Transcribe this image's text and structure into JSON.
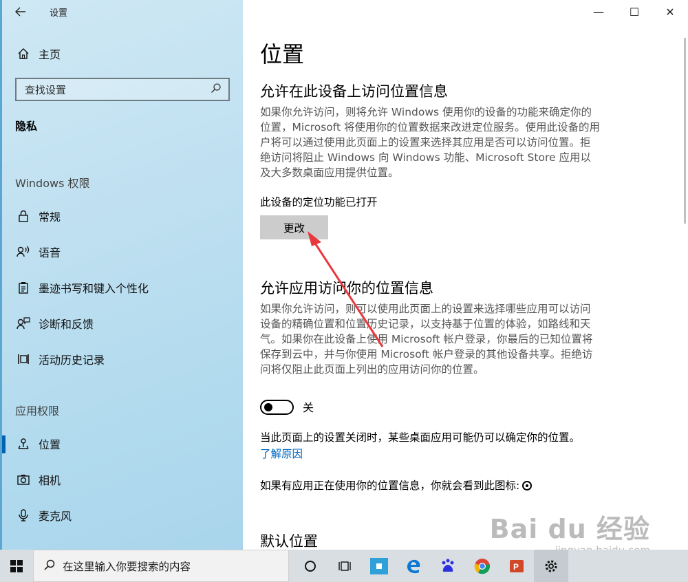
{
  "window": {
    "title": "设置",
    "controls": {
      "minimize": "—",
      "maximize": "☐",
      "close": "✕"
    }
  },
  "sidebar": {
    "home_label": "主页",
    "search_placeholder": "查找设置",
    "category": "隐私",
    "section_windows": "Windows 权限",
    "windows_items": [
      {
        "label": "常规",
        "icon": "lock-icon"
      },
      {
        "label": "语音",
        "icon": "speech-icon"
      },
      {
        "label": "墨迹书写和键入个性化",
        "icon": "clipboard-icon"
      },
      {
        "label": "诊断和反馈",
        "icon": "feedback-icon"
      },
      {
        "label": "活动历史记录",
        "icon": "timeline-icon"
      }
    ],
    "section_app": "应用权限",
    "app_items": [
      {
        "label": "位置",
        "icon": "location-icon",
        "selected": true
      },
      {
        "label": "相机",
        "icon": "camera-icon"
      },
      {
        "label": "麦克风",
        "icon": "microphone-icon"
      }
    ]
  },
  "main": {
    "page_title": "位置",
    "device_section": {
      "heading": "允许在此设备上访问位置信息",
      "description": "如果你允许访问，则将允许 Windows 使用你的设备的功能来确定你的位置，Microsoft 将使用你的位置数据来改进定位服务。使用此设备的用户将可以通过使用此页面上的设置来选择其应用是否可以访问位置。拒绝访问将阻止 Windows 向 Windows 功能、Microsoft Store 应用以及大多数桌面应用提供位置。",
      "status": "此设备的定位功能已打开",
      "change_button": "更改"
    },
    "apps_section": {
      "heading": "允许应用访问你的位置信息",
      "description": "如果你允许访问，则可以使用此页面上的设置来选择哪些应用可以访问设备的精确位置和位置历史记录，以支持基于位置的体验，如路线和天气。如果你在此设备上使用 Microsoft 帐户登录，你最后的已知位置将保存到云中，并与你使用 Microsoft 帐户登录的其他设备共享。拒绝访问将仅阻止此页面上列出的应用访问你的位置。",
      "toggle_state": "关",
      "note_text": "当此页面上的设置关闭时，某些桌面应用可能仍可以确定你的位置。",
      "learn_more": "了解原因",
      "icon_note": "如果有应用正在使用你的位置信息，你就会看到此图标:"
    },
    "default_heading": "默认位置"
  },
  "watermark": {
    "main": "Bai du 经验",
    "sub": "jingyan.baidu.com"
  },
  "taskbar": {
    "search_placeholder": "在这里输入你要搜索的内容",
    "icons": [
      "cortana-icon",
      "task-view-icon",
      "app-store-icon",
      "edge-icon",
      "baidu-icon",
      "chrome-icon",
      "powerpoint-icon",
      "settings-icon"
    ]
  },
  "colors": {
    "accent": "#0063b1",
    "link": "#0067c0",
    "arrow": "#e8383d"
  }
}
